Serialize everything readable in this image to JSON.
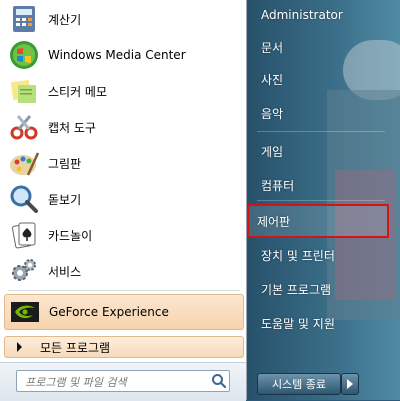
{
  "programs": [
    {
      "label": "계산기",
      "icon": "calculator-icon"
    },
    {
      "label": "Windows Media Center",
      "icon": "windows-media-center-icon"
    },
    {
      "label": "스티커 메모",
      "icon": "sticky-notes-icon"
    },
    {
      "label": "캡처 도구",
      "icon": "snipping-tool-icon"
    },
    {
      "label": "그림판",
      "icon": "paint-icon"
    },
    {
      "label": "돋보기",
      "icon": "magnifier-icon"
    },
    {
      "label": "카드놀이",
      "icon": "solitaire-icon"
    },
    {
      "label": "서비스",
      "icon": "services-icon"
    },
    {
      "label": "GeForce Experience",
      "icon": "geforce-experience-icon"
    }
  ],
  "all_programs_label": "모든 프로그램",
  "search": {
    "placeholder": "프로그램 및 파일 검색"
  },
  "right_items": [
    {
      "label": "Administrator"
    },
    {
      "label": "문서"
    },
    {
      "label": "사진"
    },
    {
      "label": "음악"
    },
    {
      "label": "게임"
    },
    {
      "label": "컴퓨터"
    },
    {
      "label": "제어판"
    },
    {
      "label": "장치 및 프린터"
    },
    {
      "label": "기본 프로그램"
    },
    {
      "label": "도움말 및 지원"
    }
  ],
  "shutdown_label": "시스템 종료",
  "colors": {
    "selection_outline": "#d41414",
    "highlight_bg": "#f6d4ae"
  }
}
